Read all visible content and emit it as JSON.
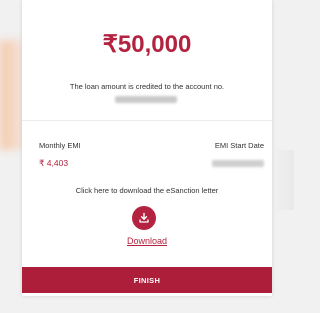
{
  "loan": {
    "amount": "₹50,000",
    "credited_text": "The loan amount is credited to the account no."
  },
  "emi": {
    "monthly_label": "Monthly EMI",
    "monthly_value": "₹ 4,403",
    "start_label": "EMI Start Date"
  },
  "download": {
    "prompt": "Click here to download the eSanction letter",
    "icon": "download-icon",
    "link_label": "Download"
  },
  "actions": {
    "finish_label": "FINISH"
  },
  "colors": {
    "accent": "#b3233f",
    "button": "#ad1e3a"
  }
}
